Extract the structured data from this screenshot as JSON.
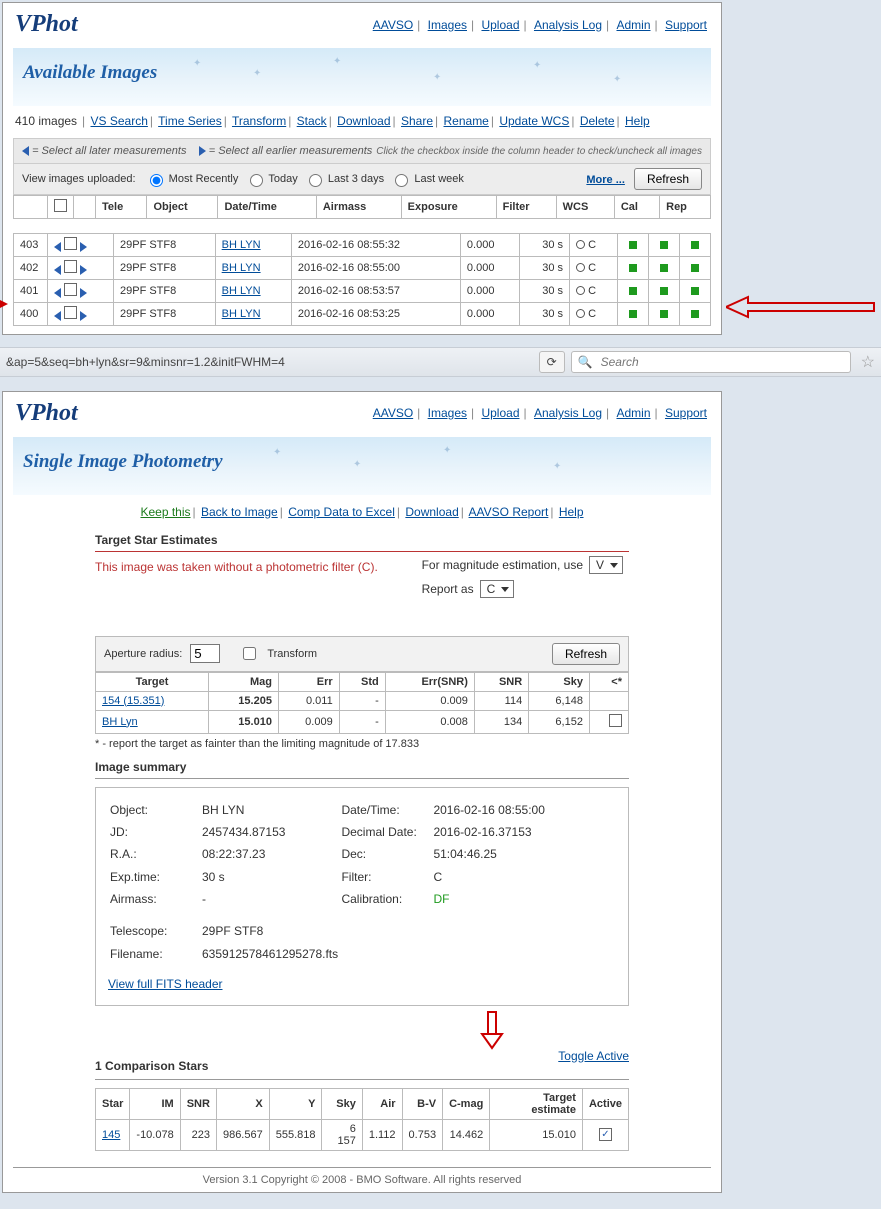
{
  "app": {
    "logo": "VPhot"
  },
  "nav": [
    "AAVSO",
    "Images",
    "Upload",
    "Analysis Log",
    "Admin",
    "Support"
  ],
  "panel1": {
    "banner_title": "Available Images",
    "count": "410 images",
    "tools": [
      "VS Search",
      "Time Series",
      "Transform",
      "Stack",
      "Download",
      "Share",
      "Rename",
      "Update WCS",
      "Delete",
      "Help"
    ],
    "sel_later": "= Select all later measurements",
    "sel_earlier": "= Select all earlier measurements",
    "hint": "Click the checkbox inside the column header to check/uncheck all images",
    "filter_label": "View images uploaded:",
    "filter_options": [
      "Most Recently",
      "Today",
      "Last 3 days",
      "Last week"
    ],
    "more": "More ...",
    "refresh": "Refresh",
    "columns": [
      "",
      "",
      "",
      "Tele",
      "Object",
      "Date/Time",
      "Airmass",
      "Exposure",
      "Filter",
      "WCS",
      "Cal",
      "Rep"
    ],
    "rows": [
      {
        "num": "403",
        "tele": "29PF STF8",
        "obj": "BH LYN",
        "dt": "2016-02-16 08:55:32",
        "air": "0.000",
        "exp": "30 s",
        "filter": "C"
      },
      {
        "num": "402",
        "tele": "29PF STF8",
        "obj": "BH LYN",
        "dt": "2016-02-16 08:55:00",
        "air": "0.000",
        "exp": "30 s",
        "filter": "C"
      },
      {
        "num": "401",
        "tele": "29PF STF8",
        "obj": "BH LYN",
        "dt": "2016-02-16 08:53:57",
        "air": "0.000",
        "exp": "30 s",
        "filter": "C"
      },
      {
        "num": "400",
        "tele": "29PF STF8",
        "obj": "BH LYN",
        "dt": "2016-02-16 08:53:25",
        "air": "0.000",
        "exp": "30 s",
        "filter": "C"
      }
    ]
  },
  "addrbar": {
    "url": "&ap=5&seq=bh+lyn&sr=9&minsnr=1.2&initFWHM=4",
    "search_ph": "Search"
  },
  "panel2": {
    "banner_title": "Single Image Photometry",
    "subnav": [
      "Keep this",
      "Back to Image",
      "Comp Data to Excel",
      "Download",
      "AAVSO Report",
      "Help"
    ],
    "sect_target": "Target Star Estimates",
    "warn": "This image was taken without a photometric filter (C).",
    "ctl_mag": "For magnitude estimation, use",
    "ctl_mag_val": "V",
    "ctl_rep": "Report as",
    "ctl_rep_val": "C",
    "aperture_label": "Aperture radius:",
    "aperture_val": "5",
    "transform": "Transform",
    "refresh": "Refresh",
    "tgt_cols": [
      "Target",
      "Mag",
      "Err",
      "Std",
      "Err(SNR)",
      "SNR",
      "Sky",
      "<*"
    ],
    "tgt_rows": [
      {
        "t": "154 (15.351)",
        "mag": "15.205",
        "err": "0.011",
        "std": "-",
        "esnr": "0.009",
        "snr": "114",
        "sky": "6,148",
        "lt": ""
      },
      {
        "t": "BH Lyn",
        "mag": "15.010",
        "err": "0.009",
        "std": "-",
        "esnr": "0.008",
        "snr": "134",
        "sky": "6,152",
        "lt": "[]"
      }
    ],
    "tgt_foot": "* - report the target as fainter than the limiting magnitude of 17.833",
    "sect_summary": "Image summary",
    "summary": {
      "object_l": "Object:",
      "object": "BH LYN",
      "dt_l": "Date/Time:",
      "dt": "2016-02-16 08:55:00",
      "jd_l": "JD:",
      "jd": "2457434.87153",
      "dd_l": "Decimal Date:",
      "dd": "2016-02-16.37153",
      "ra_l": "R.A.:",
      "ra": "08:22:37.23",
      "dec_l": "Dec:",
      "dec": "51:04:46.25",
      "exp_l": "Exp.time:",
      "exp": "30 s",
      "filter_l": "Filter:",
      "filter": "C",
      "air_l": "Airmass:",
      "air": "-",
      "cal_l": "Calibration:",
      "cal": "DF",
      "tele_l": "Telescope:",
      "tele": "29PF STF8",
      "file_l": "Filename:",
      "file": "635912578461295278.fts",
      "fits": "View full FITS header"
    },
    "sect_comp": "1 Comparison Stars",
    "toggle": "Toggle Active",
    "comp_cols": [
      "Star",
      "IM",
      "SNR",
      "X",
      "Y",
      "Sky",
      "Air",
      "B-V",
      "C-mag",
      "Target estimate",
      "Active"
    ],
    "comp_row": {
      "star": "145",
      "im": "-10.078",
      "snr": "223",
      "x": "986.567",
      "y": "555.818",
      "sky": "6 157",
      "air": "1.112",
      "bv": "0.753",
      "cmag": "14.462",
      "te": "15.010"
    }
  },
  "copyright": "Version 3.1 Copyright © 2008 - BMO Software. All rights reserved"
}
